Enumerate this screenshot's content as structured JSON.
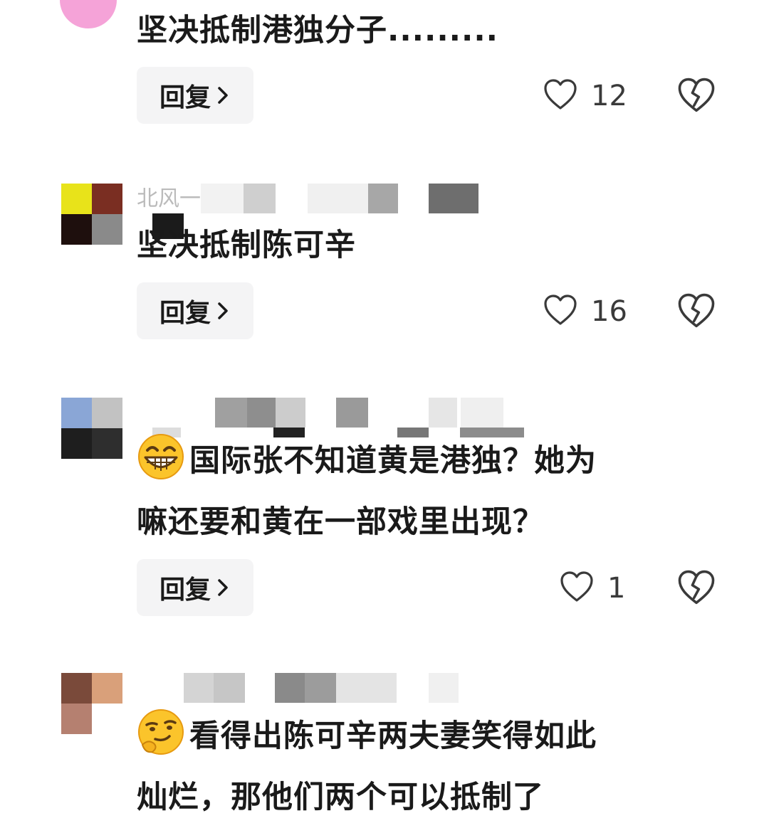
{
  "comments": [
    {
      "text": "坚决抵制港独分子.........",
      "reply_label": "回复",
      "likes": "12"
    },
    {
      "username": "北风一",
      "text": "坚决抵制陈可辛",
      "reply_label": "回复",
      "likes": "16"
    },
    {
      "emoji": "grinning-face-icon",
      "text_line1": "国际张不知道黄是港独？她为",
      "text_line2": "嘛还要和黄在一部戏里出现？",
      "reply_label": "回复",
      "likes": "1"
    },
    {
      "emoji": "smirking-face-icon",
      "text_line1": "看得出陈可辛两夫妻笑得如此",
      "text_line2": "灿烂，那他们两个可以抵制了"
    }
  ],
  "colors": {
    "reply_bg": "#f4f4f5",
    "text": "#1a1a1a",
    "icon_stroke": "#3a3a3a"
  }
}
